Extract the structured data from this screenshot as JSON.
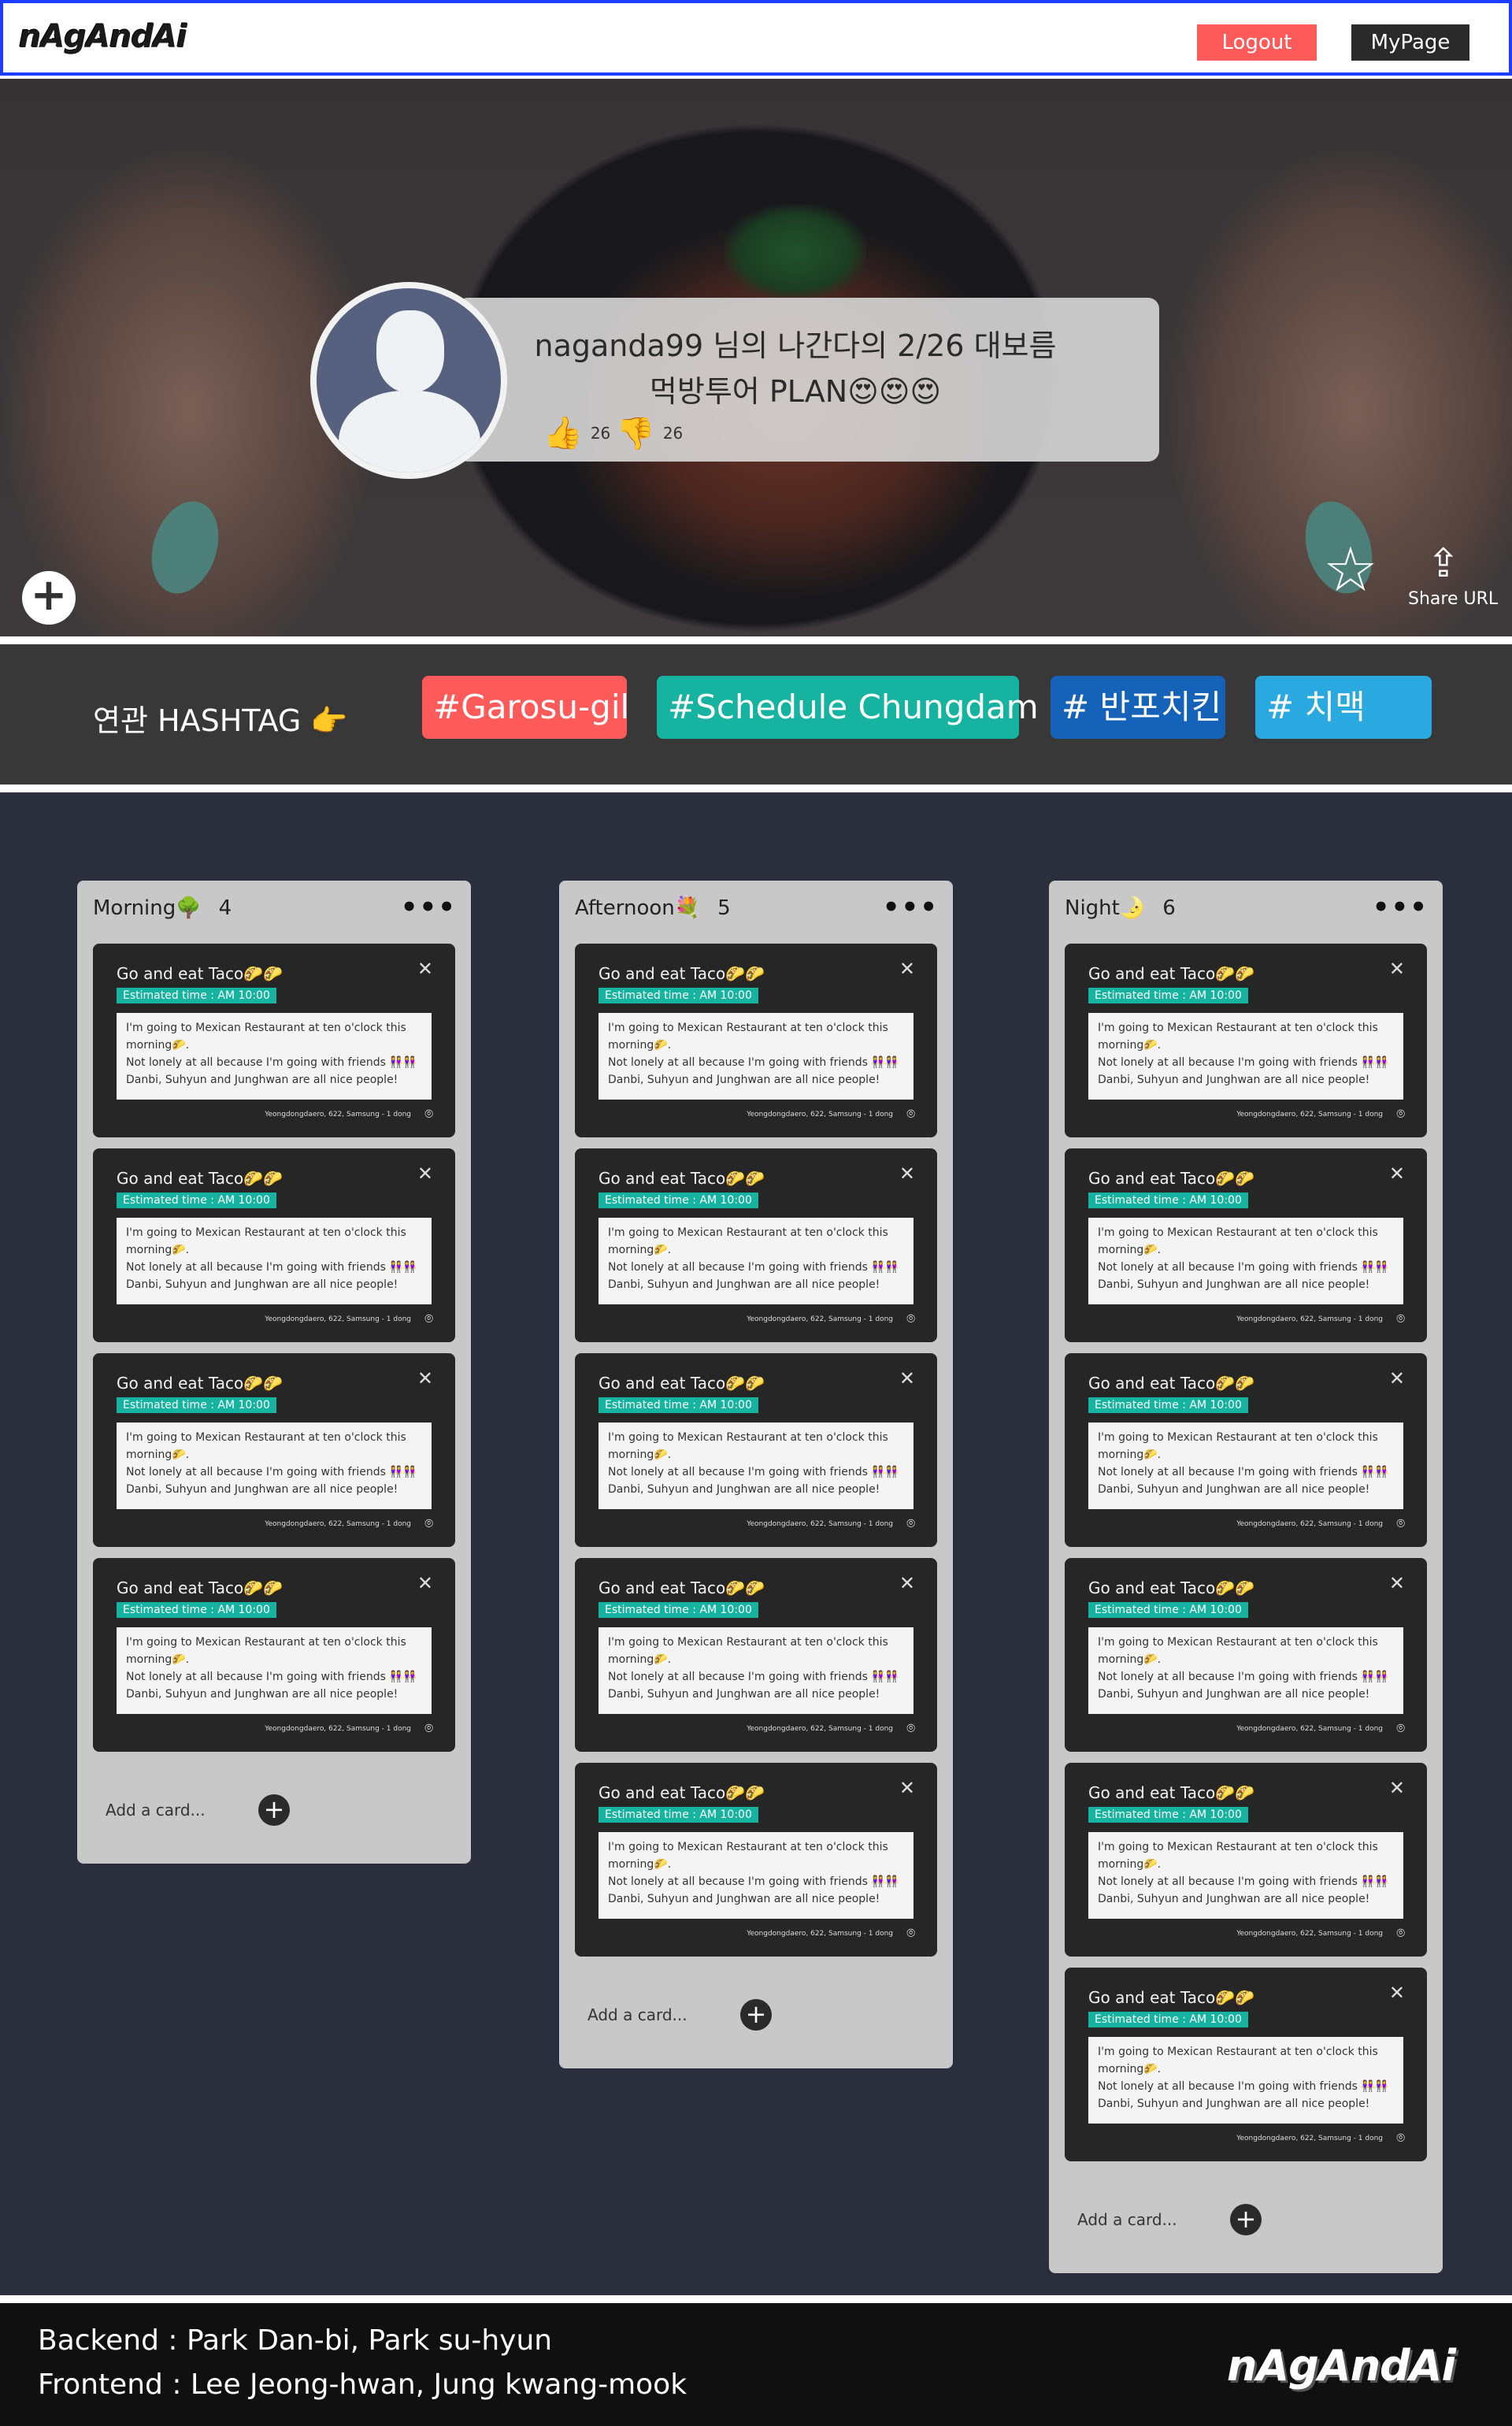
{
  "header": {
    "logo": "nAgAndAi",
    "logout_label": "Logout",
    "mypage_label": "MyPage"
  },
  "hero": {
    "plan_title": "naganda99 님의 나간다의 2/26 대보름 먹방투어 PLAN😍😍😍",
    "likes": "26",
    "dislikes": "26",
    "share_label": "Share URL"
  },
  "hashtags": {
    "label": "연관 HASHTAG 👉",
    "tags": [
      {
        "text": "#Garosu-gil",
        "color": "#ff5a5a"
      },
      {
        "text": "#Schedule Chungdam",
        "color": "#17b3a1"
      },
      {
        "text": "# 반포치킨",
        "color": "#1463b8"
      },
      {
        "text": "#     치맥",
        "color": "#29a9e0"
      }
    ]
  },
  "card_template": {
    "title": "Go and eat Taco🌮🌮",
    "badge": "Estimated time : AM 10:00",
    "desc_line1": "I'm going to Mexican Restaurant  at ten o'clock this morning🌮.",
    "desc_line2": "Not lonely at all because I'm going with friends 👭👭",
    "desc_line3": "Danbi, Suhyun and Junghwan are all nice people!",
    "address": "Yeongdongdaero, 622, Samsung - 1 dong"
  },
  "columns": [
    {
      "name": "Morning🌳",
      "count": "4"
    },
    {
      "name": "Afternoon💐",
      "count": "5"
    },
    {
      "name": "Night🌛",
      "count": "6"
    }
  ],
  "add_card_label": "Add a card...",
  "footer": {
    "backend": "Backend : Park Dan-bi, Park su-hyun",
    "frontend": "Frontend :  Lee Jeong-hwan, Jung kwang-mook",
    "logo": "nAgAndAi"
  }
}
